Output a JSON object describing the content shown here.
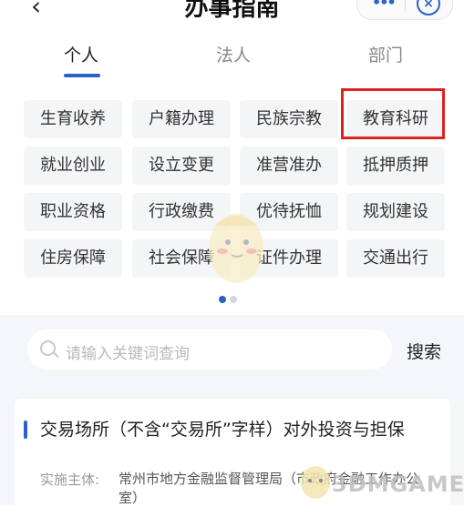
{
  "header": {
    "back_icon": "chevron-left-icon",
    "title": "办事指南",
    "more_icon": "more-dots-icon",
    "close_icon": "close-circle-icon"
  },
  "tabs": [
    {
      "label": "个人",
      "active": true
    },
    {
      "label": "法人",
      "active": false
    },
    {
      "label": "部门",
      "active": false
    }
  ],
  "categories": [
    [
      "生育收养",
      "户籍办理",
      "民族宗教",
      "教育科研"
    ],
    [
      "就业创业",
      "设立变更",
      "准营准办",
      "抵押质押"
    ],
    [
      "职业资格",
      "行政缴费",
      "优待抚恤",
      "规划建设"
    ],
    [
      "住房保障",
      "社会保障",
      "证件办理",
      "交通出行"
    ]
  ],
  "highlighted_category": "教育科研",
  "pagination": {
    "pages": 2,
    "current": 1
  },
  "search": {
    "placeholder": "请输入关键词查询",
    "button_label": "搜索"
  },
  "result": {
    "title": "交易场所（不含“交易所”字样）对外投资与担保",
    "label": "实施主体:",
    "value": "常州市地方金融监督管理局（市政府金融工作办公室）"
  },
  "watermark": {
    "text": "3DMGAME"
  },
  "colors": {
    "accent": "#2a61c9",
    "highlight": "#e02020",
    "panel": "#f4f6f9"
  }
}
